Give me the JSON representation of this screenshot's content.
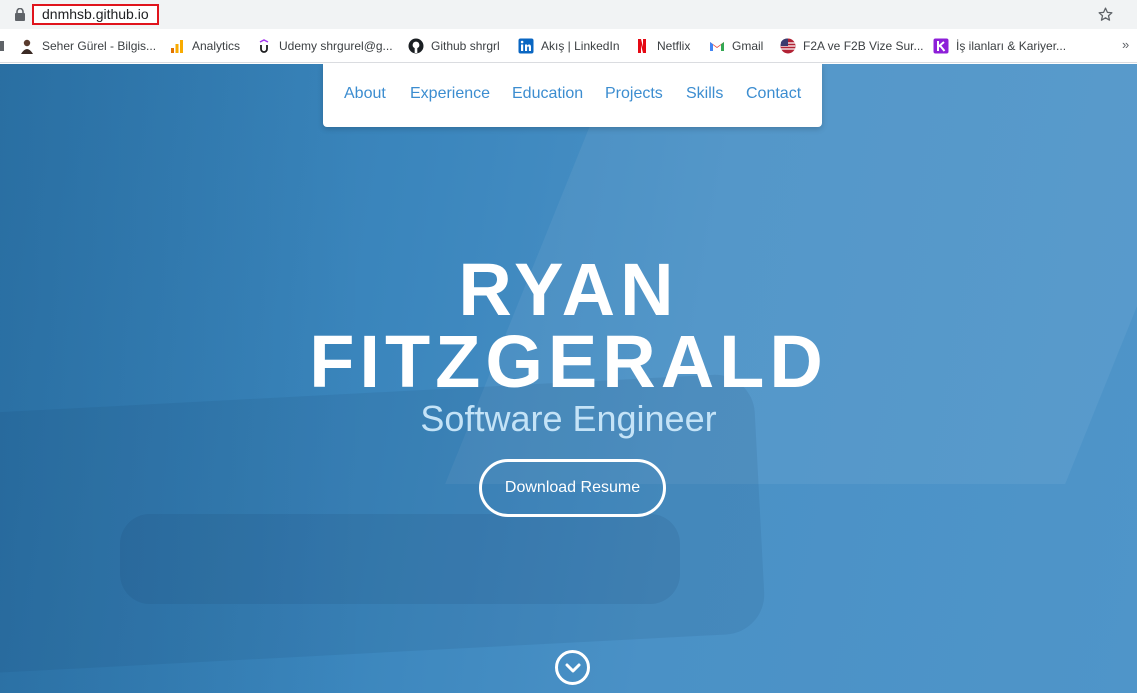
{
  "browser": {
    "url": "dnmhsb.github.io",
    "bookmarks": [
      {
        "label": "Seher Gürel - Bilgis...",
        "icon": "person-icon"
      },
      {
        "label": "Analytics",
        "icon": "analytics-icon"
      },
      {
        "label": "Udemy shrgurel@g...",
        "icon": "udemy-icon"
      },
      {
        "label": "Github shrgrl",
        "icon": "github-icon"
      },
      {
        "label": "Akış | LinkedIn",
        "icon": "linkedin-icon"
      },
      {
        "label": "Netflix",
        "icon": "netflix-icon"
      },
      {
        "label": "Gmail",
        "icon": "gmail-icon"
      },
      {
        "label": "F2A ve F2B Vize Sur...",
        "icon": "flag-icon"
      },
      {
        "label": "İş ilanları & Kariyer...",
        "icon": "kariyer-icon"
      }
    ],
    "more_label": "»"
  },
  "nav": {
    "items": [
      {
        "label": "About"
      },
      {
        "label": "Experience"
      },
      {
        "label": "Education"
      },
      {
        "label": "Projects"
      },
      {
        "label": "Skills"
      },
      {
        "label": "Contact"
      }
    ]
  },
  "hero": {
    "name_line1": "RYAN",
    "name_line2": "FITZGERALD",
    "subtitle": "Software Engineer",
    "button_label": "Download Resume"
  },
  "colors": {
    "hero_bg": "#3b86bd",
    "nav_link": "#3c8dd0",
    "subtitle": "#c4e3f7",
    "url_highlight": "#e0141c"
  }
}
